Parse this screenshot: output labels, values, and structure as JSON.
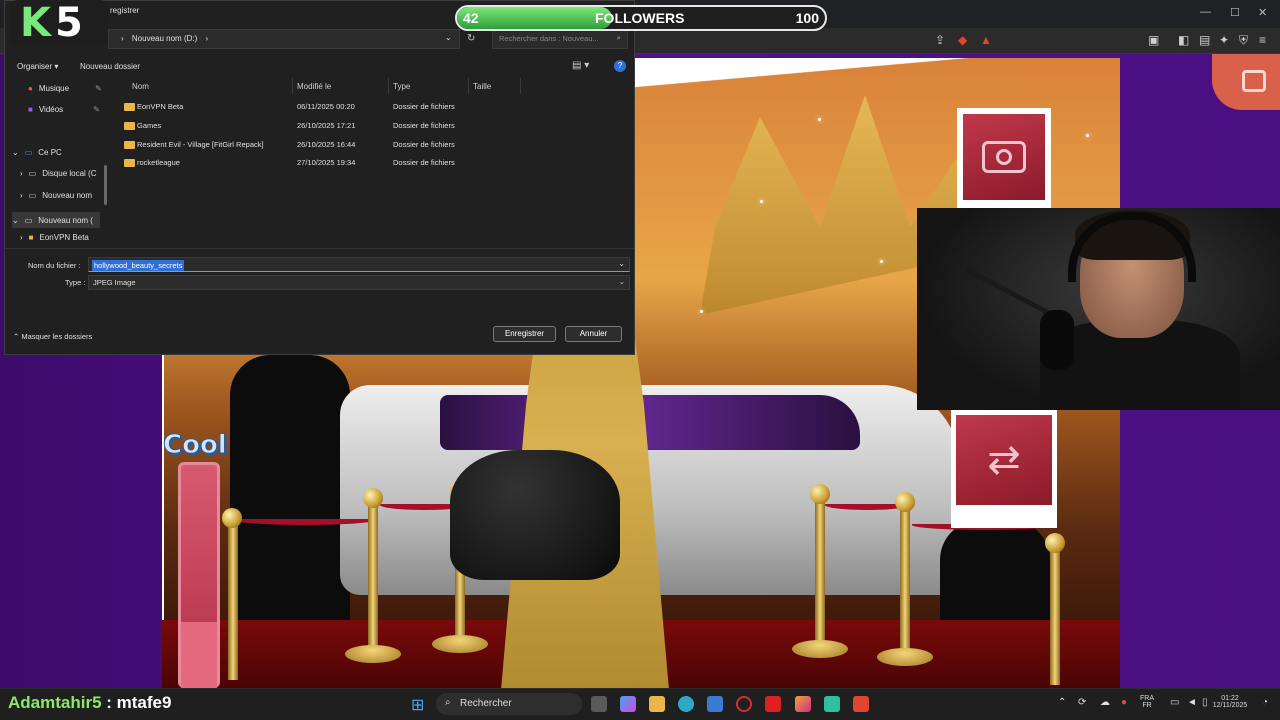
{
  "followers": {
    "current": "42",
    "label": "FOLLOWERS",
    "goal": "100",
    "fraction": 0.42
  },
  "logo": {
    "k": "K",
    "five": "5"
  },
  "dialog": {
    "title_partial": "registrer",
    "breadcrumb_sep": "›",
    "breadcrumb": "Nouveau nom (D:)",
    "search_placeholder": "Rechercher dans : Nouveau...",
    "toolbar": {
      "organize": "Organiser",
      "new_folder": "Nouveau dossier"
    },
    "nav": {
      "music": "Musique",
      "videos": "Vidéos",
      "this_pc": "Ce PC",
      "local_disk": "Disque local (C",
      "new_name_1": "Nouveau nom",
      "new_name_2": "Nouveau nom (",
      "eonvpn": "EonVPN Beta"
    },
    "columns": {
      "name": "Nom",
      "modified": "Modifié le",
      "type": "Type",
      "size": "Taille"
    },
    "rows": [
      {
        "name": "EonVPN Beta",
        "modified": "06/11/2025 00:20",
        "type": "Dossier de fichiers"
      },
      {
        "name": "Games",
        "modified": "26/10/2025 17:21",
        "type": "Dossier de fichiers"
      },
      {
        "name": "Resident Evil - Village [FitGirl Repack]",
        "modified": "26/10/2025 16:44",
        "type": "Dossier de fichiers"
      },
      {
        "name": "rocketleague",
        "modified": "27/10/2025 19:34",
        "type": "Dossier de fichiers"
      }
    ],
    "filename_label": "Nom du fichier :",
    "filename_value": "hollywood_beauty_secrets",
    "type_label": "Type :",
    "type_value": "JPEG Image",
    "hide_folders": "Masquer les dossiers",
    "save": "Enregistrer",
    "cancel": "Annuler"
  },
  "game": {
    "cool_label": "Cool",
    "meter_level": 0.3
  },
  "chat": {
    "user": "Adamtahir5",
    "message": ": mtafe9"
  },
  "taskbar": {
    "search": "Rechercher",
    "lang_top": "FRA",
    "lang_bottom": "FR",
    "time": "01:22",
    "date": "12/11/2025"
  },
  "colors": {
    "accent_blue": "#2f6fd6",
    "followers_green": "#2f9e3a",
    "game_purple": "#52128e"
  }
}
